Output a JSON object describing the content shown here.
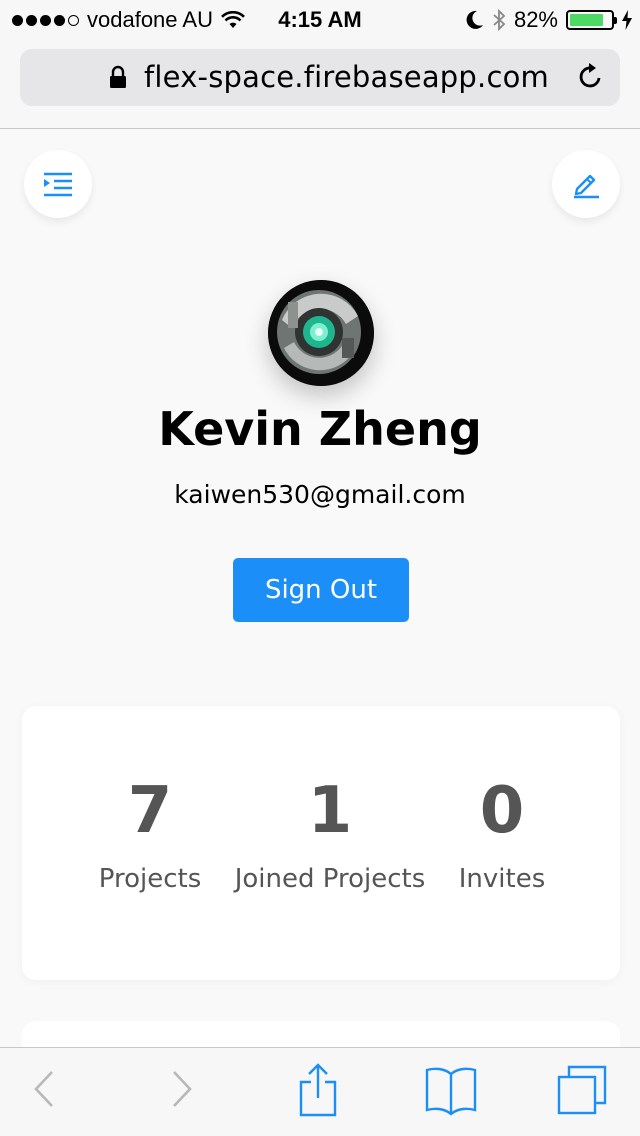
{
  "status_bar": {
    "carrier": "vodafone AU",
    "time": "4:15 AM",
    "battery_percent": "82%",
    "battery_level": 0.82,
    "signal_bars": 4
  },
  "browser": {
    "url": "flex-space.firebaseapp.com"
  },
  "profile": {
    "name": "Kevin Zheng",
    "email": "kaiwen530@gmail.com",
    "sign_out_label": "Sign Out"
  },
  "stats": [
    {
      "value": "7",
      "label": "Projects"
    },
    {
      "value": "1",
      "label": "Joined Projects"
    },
    {
      "value": "0",
      "label": "Invites"
    }
  ],
  "colors": {
    "accent": "#1b8ff7",
    "battery": "#4cd964",
    "toolbar_icon": "#1b8ff7",
    "toolbar_disabled": "#b8b8b8"
  },
  "icons": {
    "menu": "menu-indent-icon",
    "edit": "pencil-icon",
    "back": "chevron-left-icon",
    "forward": "chevron-right-icon",
    "share": "share-icon",
    "bookmarks": "book-icon",
    "tabs": "tabs-icon"
  }
}
